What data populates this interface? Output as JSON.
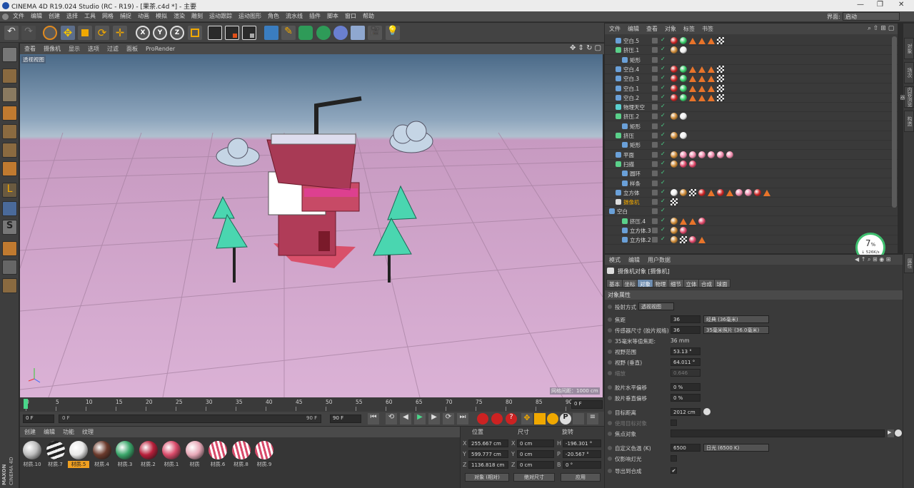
{
  "titlebar": {
    "title": "CINEMA 4D R19.024 Studio (RC - R19) - [果茶.c4d *] - 主要"
  },
  "menubar": {
    "items": [
      "文件",
      "编辑",
      "创建",
      "选择",
      "工具",
      "网格",
      "捕捉",
      "动画",
      "模拟",
      "渲染",
      "雕刻",
      "运动跟踪",
      "运动图形",
      "角色",
      "流水线",
      "插件",
      "脚本",
      "窗口",
      "帮助"
    ],
    "layout_label": "界面:",
    "layout_value": "启动"
  },
  "viewport": {
    "menu": [
      "查看",
      "摄像机",
      "显示",
      "选项",
      "过滤",
      "面板",
      "ProRender"
    ],
    "label": "透视视图",
    "grid_info": "网格间距：1000 cm"
  },
  "timeline": {
    "ticks": [
      "0",
      "5",
      "10",
      "15",
      "20",
      "25",
      "30",
      "35",
      "40",
      "45",
      "50",
      "55",
      "60",
      "65",
      "70",
      "75",
      "80",
      "85",
      "90"
    ],
    "frame_right": "0 F"
  },
  "transport": {
    "start": "0 F",
    "range_start": "0 F",
    "range_end": "90 F",
    "end": "90 F"
  },
  "materials": {
    "menu": [
      "创建",
      "编辑",
      "功能",
      "纹理"
    ],
    "items": [
      {
        "label": "材质.10",
        "color": "#bdbdbd",
        "style": "plain"
      },
      {
        "label": "材质.7",
        "color": "#222222",
        "style": "stripe-bw"
      },
      {
        "label": "材质.5",
        "color": "#e8e8e8",
        "style": "plain",
        "selected": true
      },
      {
        "label": "材质.4",
        "color": "#6b3a2c",
        "style": "plain"
      },
      {
        "label": "材质.3",
        "color": "#3aa66a",
        "style": "plain"
      },
      {
        "label": "材质.2",
        "color": "#b81f3a",
        "style": "plain"
      },
      {
        "label": "材质.1",
        "color": "#d94b6a",
        "style": "plain"
      },
      {
        "label": "材质",
        "color": "#e8a9b8",
        "style": "plain"
      },
      {
        "label": "材质.6",
        "color": "#d84a6a",
        "style": "stripe-pink"
      },
      {
        "label": "材质.8",
        "color": "#d84a6a",
        "style": "stripe-pink"
      },
      {
        "label": "材质.9",
        "color": "#d84a6a",
        "style": "stripe-pink"
      }
    ]
  },
  "coords": {
    "headers": [
      "位置",
      "尺寸",
      "旋转"
    ],
    "rows": [
      {
        "axis": "X",
        "pos": "255.667 cm",
        "size_axis": "X",
        "size": "0 cm",
        "rot_axis": "H",
        "rot": "-196.301 °"
      },
      {
        "axis": "Y",
        "pos": "599.777 cm",
        "size_axis": "Y",
        "size": "0 cm",
        "rot_axis": "P",
        "rot": "-20.567 °"
      },
      {
        "axis": "Z",
        "pos": "1136.818 cm",
        "size_axis": "Z",
        "size": "0 cm",
        "rot_axis": "B",
        "rot": "0 °"
      }
    ],
    "mode": "对象 (相对)",
    "size_mode": "绝对尺寸",
    "apply": "应用"
  },
  "objects": {
    "menu": [
      "文件",
      "编辑",
      "查看",
      "对象",
      "标签",
      "书签"
    ],
    "rows": [
      {
        "name": "空白.5",
        "indent": 1,
        "icon": "null"
      },
      {
        "name": "挤压.1",
        "indent": 1,
        "icon": "extrude"
      },
      {
        "name": "矩形",
        "indent": 2,
        "icon": "spline"
      },
      {
        "name": "空白.4",
        "indent": 1,
        "icon": "null"
      },
      {
        "name": "空白.3",
        "indent": 1,
        "icon": "null"
      },
      {
        "name": "空白.1",
        "indent": 1,
        "icon": "null"
      },
      {
        "name": "空白.2",
        "indent": 1,
        "icon": "null"
      },
      {
        "name": "物理天空",
        "indent": 1,
        "icon": "sky"
      },
      {
        "name": "挤压.2",
        "indent": 1,
        "icon": "extrude"
      },
      {
        "name": "矩形",
        "indent": 2,
        "icon": "spline"
      },
      {
        "name": "挤压",
        "indent": 1,
        "icon": "extrude"
      },
      {
        "name": "矩形",
        "indent": 2,
        "icon": "spline"
      },
      {
        "name": "平面",
        "indent": 1,
        "icon": "plane"
      },
      {
        "name": "扫描",
        "indent": 1,
        "icon": "sweep"
      },
      {
        "name": "圆环",
        "indent": 2,
        "icon": "circle"
      },
      {
        "name": "样条",
        "indent": 2,
        "icon": "spline"
      },
      {
        "name": "立方体",
        "indent": 1,
        "icon": "cube"
      },
      {
        "name": "摄像机",
        "indent": 1,
        "icon": "camera",
        "highlight": true
      },
      {
        "name": "空白",
        "indent": 0,
        "icon": "null"
      },
      {
        "name": "挤压.4",
        "indent": 2,
        "icon": "extrude"
      },
      {
        "name": "立方体.3",
        "indent": 2,
        "icon": "cube"
      },
      {
        "name": "立方体.2",
        "indent": 2,
        "icon": "cube"
      }
    ]
  },
  "attributes": {
    "menu": [
      "模式",
      "编辑",
      "用户数据"
    ],
    "object_title": "摄像机对象 [摄像机]",
    "tabs": [
      "基本",
      "坐标",
      "对象",
      "物理",
      "细节",
      "立体",
      "合成",
      "球面"
    ],
    "active_tab": "对象",
    "section": "对象属性",
    "fields": [
      {
        "label": "投射方式",
        "value": "透视视图",
        "kind": "dropdown"
      },
      {
        "label": "焦距",
        "value": "36",
        "extra": "经典 (36毫米)"
      },
      {
        "label": "传感器尺寸 (胶片规格)",
        "value": "36",
        "extra": "35毫米照片 (36.0毫米)"
      },
      {
        "label": "35毫米等值焦距:",
        "value": "36 mm",
        "kind": "text"
      },
      {
        "label": "视野范围",
        "value": "53.13 °"
      },
      {
        "label": "视野 (垂直)",
        "value": "64.011 °"
      },
      {
        "label": "缩放",
        "value": "0.646",
        "kind": "disabled"
      },
      {
        "label": "胶片水平偏移",
        "value": "0 %"
      },
      {
        "label": "胶片垂直偏移",
        "value": "0 %"
      },
      {
        "label": "目标距离",
        "value": "2012 cm"
      },
      {
        "label": "使用目标对象",
        "value": "",
        "kind": "disabled-check"
      },
      {
        "label": "焦点对象",
        "value": "",
        "kind": "link"
      },
      {
        "label": "自定义色温 (K)",
        "value": "6500",
        "extra": "日光 (6500 K)"
      },
      {
        "label": "仅影响灯光",
        "value": "",
        "kind": "check"
      },
      {
        "label": "导出到合成",
        "value": "✔",
        "kind": "check"
      }
    ]
  },
  "perf": {
    "percent": "7",
    "unit": "%",
    "speed": "↓ 526K/s"
  },
  "rightstrip": {
    "tabs": [
      "对象",
      "场次",
      "内容浏览器",
      "构造"
    ],
    "tabs2": [
      "属性"
    ]
  },
  "brand": {
    "maxon": "MAXON",
    "cinema": "CINEMA 4D"
  }
}
